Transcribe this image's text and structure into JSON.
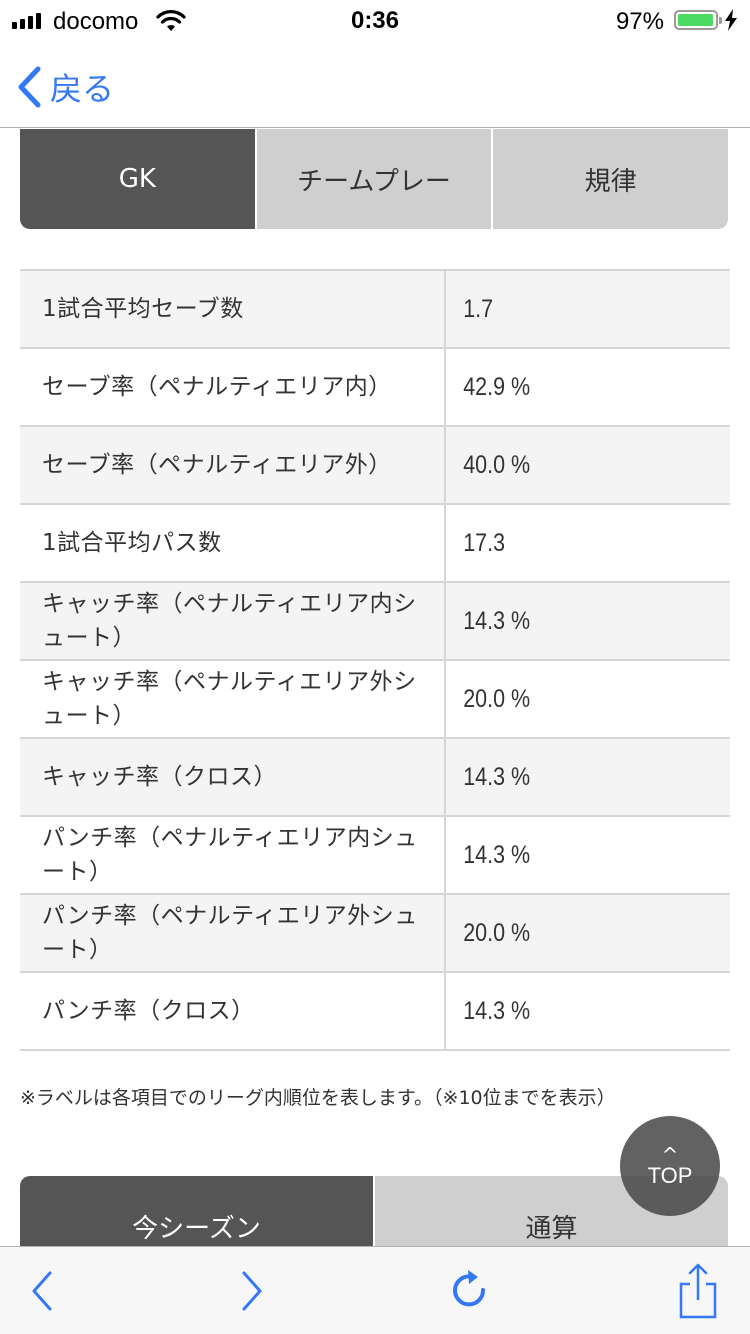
{
  "status_bar": {
    "carrier": "docomo",
    "time": "0:36",
    "battery_percent": "97%",
    "battery_level": 0.97,
    "icons": [
      "signal-icon",
      "wifi-icon",
      "battery-icon",
      "charging-bolt-icon"
    ]
  },
  "nav": {
    "back_label": "戻る",
    "back_icon": "chevron-left-icon",
    "accent_color": "#3478f6"
  },
  "tabs": [
    {
      "label": "GK",
      "active": true
    },
    {
      "label": "チームプレー",
      "active": false
    },
    {
      "label": "規律",
      "active": false
    }
  ],
  "stats": [
    {
      "label": "1試合平均セーブ数",
      "value": "1.7"
    },
    {
      "label": "セーブ率（ペナルティエリア内）",
      "value": "42.9 %"
    },
    {
      "label": "セーブ率（ペナルティエリア外）",
      "value": "40.0 %"
    },
    {
      "label": "1試合平均パス数",
      "value": "17.3"
    },
    {
      "label": "キャッチ率（ペナルティエリア内シュート）",
      "value": "14.3 %"
    },
    {
      "label": "キャッチ率（ペナルティエリア外シュート）",
      "value": "20.0 %"
    },
    {
      "label": "キャッチ率（クロス）",
      "value": "14.3 %"
    },
    {
      "label": "パンチ率（ペナルティエリア内シュート）",
      "value": "14.3 %"
    },
    {
      "label": "パンチ率（ペナルティエリア外シュート）",
      "value": "20.0 %"
    },
    {
      "label": "パンチ率（クロス）",
      "value": "14.3 %"
    }
  ],
  "note": "※ラベルは各項目でのリーグ内順位を表します。（※10位までを表示）",
  "season_tabs": [
    {
      "label": "今シーズン",
      "active": true
    },
    {
      "label": "通算",
      "active": false
    }
  ],
  "top_button": {
    "label": "TOP",
    "arrow": "^"
  },
  "toolbar": {
    "icons": [
      "back-arrow-icon",
      "forward-arrow-icon",
      "reload-icon",
      "share-icon"
    ]
  },
  "colors": {
    "active_tab": "#555555",
    "inactive_tab": "#cfcfcf",
    "row_alt": "#f4f4f4"
  }
}
